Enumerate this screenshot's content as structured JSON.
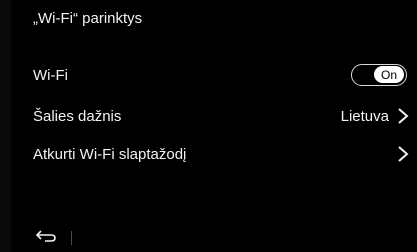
{
  "header": {
    "title": "„Wi-Fi“ parinktys"
  },
  "rows": [
    {
      "label": "Wi-Fi",
      "toggle_label": "On"
    },
    {
      "label": "Šalies dažnis",
      "value": "Lietuva"
    },
    {
      "label": "Atkurti Wi-Fi slaptažodį"
    }
  ],
  "icons": {
    "back": "back-arrow-icon",
    "chevron": "chevron-right-icon"
  },
  "colors": {
    "background": "#000000",
    "text": "#f2f2f2",
    "toggle_border": "#d9d9d9"
  }
}
